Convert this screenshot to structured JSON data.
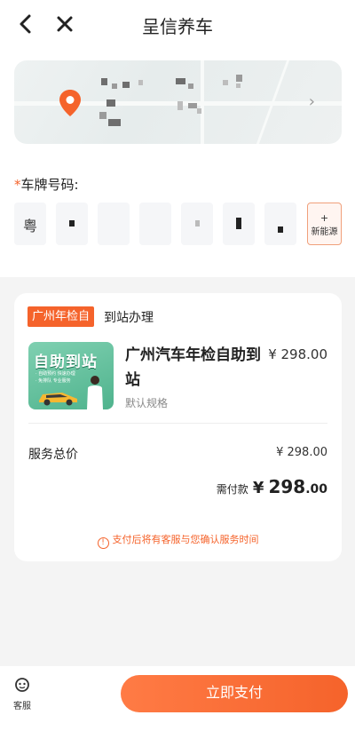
{
  "header": {
    "title": "呈信养车"
  },
  "icons": {
    "back": "chevron-left-icon",
    "close": "close-icon",
    "location": "location-pin-icon",
    "map_arrow": "chevron-right-icon",
    "info": "info-icon",
    "service": "customer-service-icon"
  },
  "location_card": {
    "arrow": "›"
  },
  "plate": {
    "label": "车牌号码:",
    "required_mark": "*",
    "province": "粤",
    "new_energy_plus": "+",
    "new_energy_label": "新能源"
  },
  "order": {
    "tag": "广州年检自",
    "tag_sub": "到站办理",
    "thumb_title": "自助到站",
    "thumb_lines": [
      "· 自助预约 快速办理",
      "· 免排队 专业服务"
    ],
    "product_name": "广州汽车年检自助到站",
    "product_price": "¥ 298.00",
    "spec": "默认规格",
    "total_label": "服务总价",
    "total_value": "¥ 298.00",
    "pay_label": "需付款",
    "pay_currency": "¥",
    "pay_int": "298",
    "pay_dec": ".00",
    "note": "支付后将有客服与您确认服务时间",
    "note_icon_text": "!"
  },
  "bottom": {
    "service_label": "客服",
    "pay_button": "立即支付"
  },
  "colors": {
    "accent": "#f5632b",
    "accent_light": "#ff7b45",
    "background": "#f4f4f4"
  }
}
